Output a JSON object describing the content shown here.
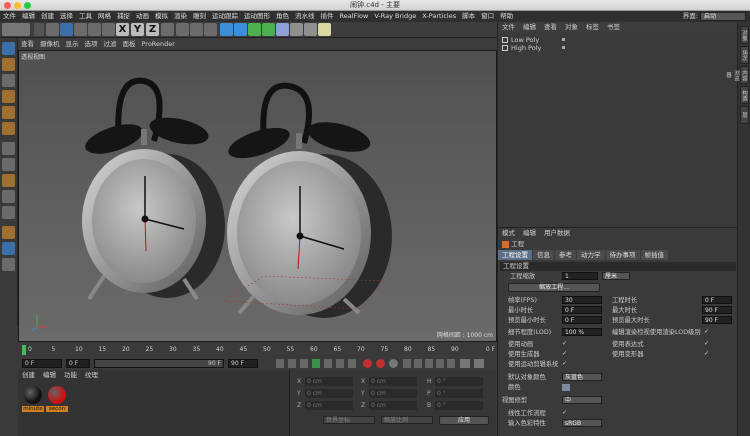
{
  "window": {
    "title": "闹钟.c4d - 主要"
  },
  "menubar": {
    "items": [
      "文件",
      "编辑",
      "创建",
      "选择",
      "工具",
      "网格",
      "捕捉",
      "动画",
      "模拟",
      "渲染",
      "雕刻",
      "运动跟踪",
      "运动图形",
      "角色",
      "流水线",
      "插件",
      "RealFlow",
      "V-Ray Bridge",
      "X-Particles",
      "脚本",
      "窗口",
      "帮助"
    ],
    "layout_label": "界面:",
    "layout_value": "启动"
  },
  "toolbar": {
    "axis_x": "X",
    "axis_y": "Y",
    "axis_z": "Z"
  },
  "viewport": {
    "menu": [
      "查看",
      "摄像机",
      "显示",
      "选项",
      "过滤",
      "面板",
      "ProRender"
    ],
    "label": "透视视图",
    "grid": "网格间距 : 1000 cm"
  },
  "timeline": {
    "ticks": [
      "0",
      "5",
      "10",
      "15",
      "20",
      "25",
      "30",
      "35",
      "40",
      "45",
      "50",
      "55",
      "60",
      "65",
      "70",
      "75",
      "80",
      "85",
      "90"
    ],
    "end_label": "0 F"
  },
  "transport": {
    "start": "0 F",
    "current": "0 F",
    "end": "90 F",
    "end2": "90 F"
  },
  "materials": {
    "menu": [
      "创建",
      "编辑",
      "功能",
      "纹理"
    ],
    "items": [
      {
        "name": "minute",
        "color": "#111111"
      },
      {
        "name": "secon",
        "color": "#cc1010"
      }
    ]
  },
  "coords": {
    "rows": [
      {
        "a": "X",
        "v1": "0 cm",
        "b": "X",
        "v2": "0 cm",
        "c": "H",
        "v3": "0 °"
      },
      {
        "a": "Y",
        "v1": "0 cm",
        "b": "Y",
        "v2": "0 cm",
        "c": "P",
        "v3": "0 °"
      },
      {
        "a": "Z",
        "v1": "0 cm",
        "b": "Z",
        "v2": "0 cm",
        "c": "B",
        "v3": "0 °"
      }
    ],
    "mode1": "世界坐标",
    "mode2": "缩放比例",
    "apply": "应用"
  },
  "objects": {
    "menu": [
      "文件",
      "编辑",
      "查看",
      "对象",
      "标签",
      "书签"
    ],
    "items": [
      "Low Poly",
      "High Poly"
    ]
  },
  "right_tabs": [
    "对象",
    "场次",
    "内容浏览器",
    "构造",
    "层"
  ],
  "attrs": {
    "menu": [
      "模式",
      "编辑",
      "用户数据"
    ],
    "header": "工程",
    "tabs": [
      "工程设置",
      "信息",
      "参考",
      "动力学",
      "待办事项",
      "帧插值"
    ],
    "section": "工程设置",
    "scale_label": "工程缩放",
    "scale_value": "1",
    "scale_unit": "厘米",
    "scale_button": "缩放工程...",
    "fps_label": "帧率(FPS)",
    "fps_value": "30",
    "duration_label": "工程时长",
    "duration_value": "0 F",
    "min_time_label": "最小时长",
    "min_time_value": "0 F",
    "max_time_label": "最大时长",
    "max_time_value": "90 F",
    "preview_min_label": "预览最小时长",
    "preview_min_value": "0 F",
    "preview_max_label": "预览最大时长",
    "preview_max_value": "90 F",
    "lod_label": "细节程度(LOD)",
    "lod_value": "100 %",
    "lod_render_label": "编辑渲染检视使用渲染LOD级别",
    "use_anim_label": "使用动画",
    "use_expr_label": "使用表达式",
    "use_gen_label": "使用生成器",
    "use_deform_label": "使用变形器",
    "use_motion_label": "使用运动剪辑系统",
    "default_color_label": "默认对象颜色",
    "default_color_value": "灰蓝色",
    "color_label": "颜色",
    "view_clip_label": "视图修剪",
    "view_clip_value": "中",
    "linear_label": "线性工作流程",
    "input_color_label": "输入色彩特性",
    "input_color_value": "sRGB"
  }
}
